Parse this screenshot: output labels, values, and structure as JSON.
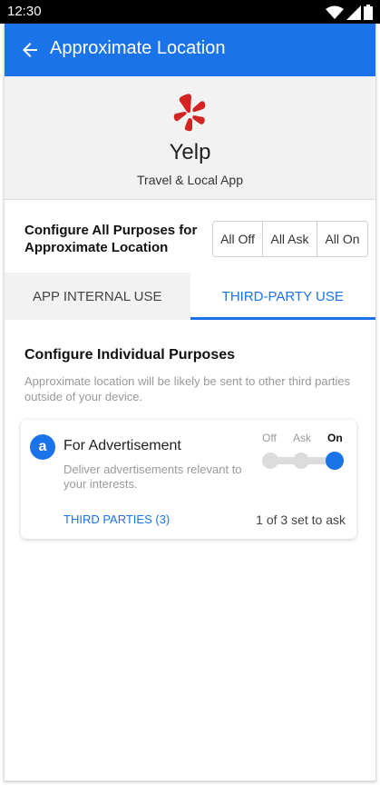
{
  "status_bar": {
    "time": "12:30"
  },
  "app_bar": {
    "title": "Approximate Location"
  },
  "app": {
    "name": "Yelp",
    "category": "Travel & Local App",
    "brand_color": "#d32323"
  },
  "config_all": {
    "label": "Configure All Purposes for Approximate Location",
    "options": [
      "All Off",
      "All Ask",
      "All On"
    ]
  },
  "tabs": [
    {
      "label": "APP INTERNAL USE",
      "active": false
    },
    {
      "label": "THIRD-PARTY USE",
      "active": true
    }
  ],
  "section": {
    "title": "Configure Individual Purposes",
    "description": "Approximate location will be likely be sent to other third parties outside of your device."
  },
  "purposes": [
    {
      "badge": "a",
      "title": "For Advertisement",
      "description": "Deliver advertisements relevant to your interests.",
      "toggle_labels": [
        "Off",
        "Ask",
        "On"
      ],
      "selected": "On",
      "third_parties_label": "THIRD PARTIES (3)",
      "ask_summary": "1 of 3 set to ask"
    }
  ],
  "colors": {
    "accent": "#1a73e8",
    "muted_text": "#999999"
  },
  "icons": {
    "back": "arrow-back-icon",
    "wifi": "wifi-icon",
    "signal": "signal-icon",
    "battery": "battery-icon"
  }
}
